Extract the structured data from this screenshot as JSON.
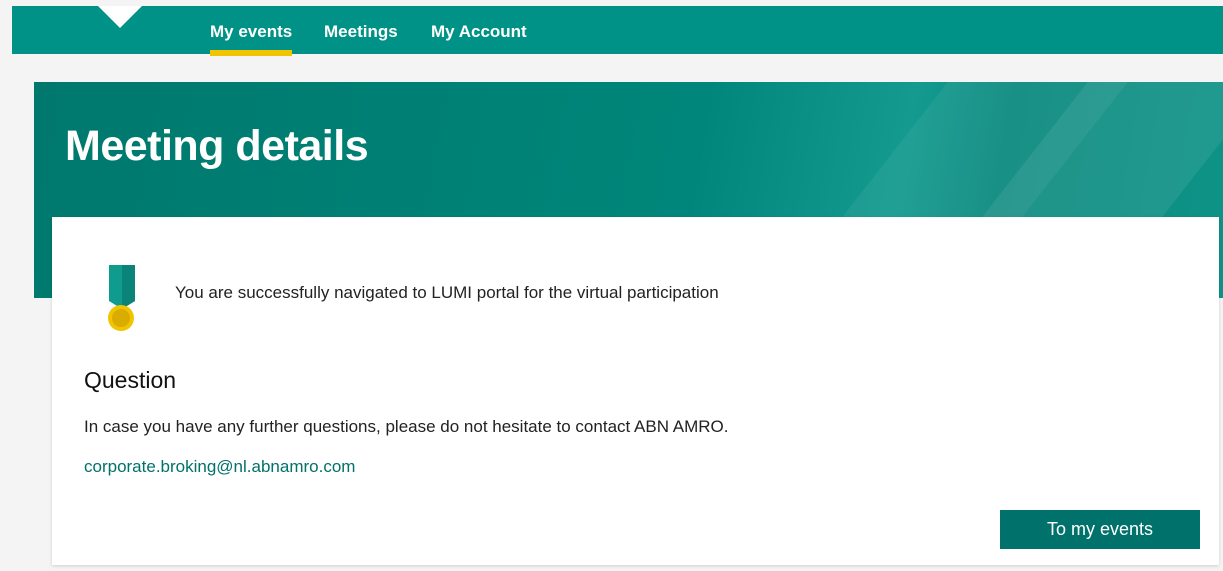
{
  "nav": {
    "items": [
      {
        "label": "My events",
        "active": true
      },
      {
        "label": "Meetings",
        "active": false
      },
      {
        "label": "My Account",
        "active": false
      }
    ]
  },
  "hero": {
    "title": "Meeting details"
  },
  "card": {
    "success_message": "You are successfully navigated to LUMI portal for the virtual participation",
    "question_heading": "Question",
    "question_text": "In case you have any further questions, please do not hesitate to contact ABN AMRO.",
    "contact_email": "corporate.broking@nl.abnamro.com",
    "button_label": "To my events"
  },
  "icons": {
    "success": "medal-icon"
  },
  "colors": {
    "brand": "#009286",
    "brand_dark": "#00716b",
    "accent": "#f1c400"
  }
}
